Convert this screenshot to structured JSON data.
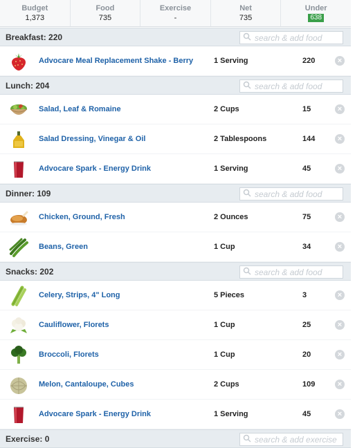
{
  "summary": {
    "budget_label": "Budget",
    "budget_value": "1,373",
    "food_label": "Food",
    "food_value": "735",
    "exercise_label": "Exercise",
    "exercise_value": "-",
    "net_label": "Net",
    "net_value": "735",
    "under_label": "Under",
    "under_value": "638",
    "under_color": "#3a9f4a"
  },
  "search_placeholder": "search & add food",
  "exercise_search_placeholder": "search & add exercise",
  "meals": [
    {
      "title": "Breakfast: 220",
      "items": [
        {
          "name": "Advocare Meal Replacement Shake - Berry",
          "qty": "1 Serving",
          "cal": "220",
          "icon": "strawberry-icon"
        }
      ]
    },
    {
      "title": "Lunch: 204",
      "items": [
        {
          "name": "Salad, Leaf & Romaine",
          "qty": "2 Cups",
          "cal": "15",
          "icon": "salad-bowl-icon"
        },
        {
          "name": "Salad Dressing, Vinegar & Oil",
          "qty": "2 Tablespoons",
          "cal": "144",
          "icon": "oil-bottle-icon"
        },
        {
          "name": "Advocare Spark - Energy Drink",
          "qty": "1 Serving",
          "cal": "45",
          "icon": "drink-glass-icon"
        }
      ]
    },
    {
      "title": "Dinner: 109",
      "items": [
        {
          "name": "Chicken, Ground, Fresh",
          "qty": "2 Ounces",
          "cal": "75",
          "icon": "roast-chicken-icon"
        },
        {
          "name": "Beans, Green",
          "qty": "1 Cup",
          "cal": "34",
          "icon": "green-beans-icon"
        }
      ]
    },
    {
      "title": "Snacks: 202",
      "items": [
        {
          "name": "Celery, Strips, 4\" Long",
          "qty": "5 Pieces",
          "cal": "3",
          "icon": "celery-icon"
        },
        {
          "name": "Cauliflower, Florets",
          "qty": "1 Cup",
          "cal": "25",
          "icon": "cauliflower-icon"
        },
        {
          "name": "Broccoli, Florets",
          "qty": "1 Cup",
          "cal": "20",
          "icon": "broccoli-icon"
        },
        {
          "name": "Melon, Cantaloupe, Cubes",
          "qty": "2 Cups",
          "cal": "109",
          "icon": "cantaloupe-icon"
        },
        {
          "name": "Advocare Spark - Energy Drink",
          "qty": "1 Serving",
          "cal": "45",
          "icon": "drink-glass-icon"
        }
      ]
    }
  ],
  "exercise": {
    "title": "Exercise: 0"
  },
  "delete_glyph": "×"
}
